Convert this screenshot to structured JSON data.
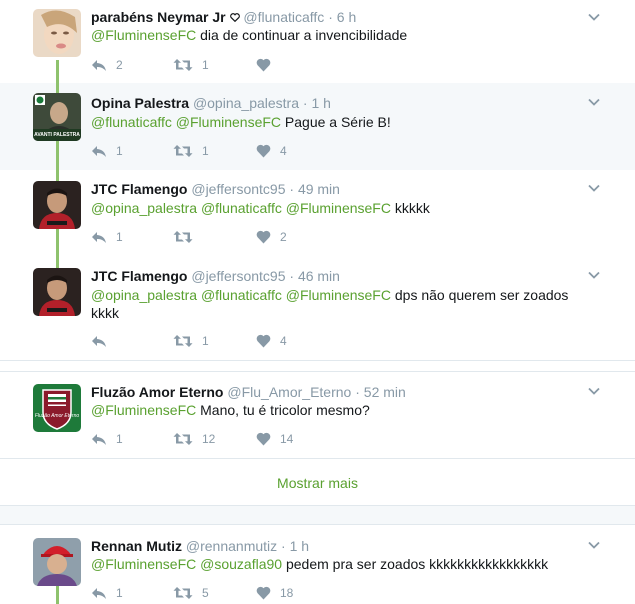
{
  "tweets": [
    {
      "name": "parabéns Neymar Jr",
      "name_badge": "heart-outline",
      "handle": "@flunaticaffc",
      "dot": "·",
      "time": "6 h",
      "text_parts": [
        "@FluminenseFC",
        " dia de continuar a invencibilidade"
      ],
      "reply_count": "2",
      "retweet_count": "1",
      "like_count": ""
    },
    {
      "name": "Opina Palestra",
      "handle": "@opina_palestra",
      "dot": "·",
      "time": "1 h",
      "avatar_text": "AVANTI PALESTRA",
      "text_parts": [
        "@flunaticaffc",
        " ",
        "@FluminenseFC",
        " Pague a Série B!"
      ],
      "reply_count": "1",
      "retweet_count": "1",
      "like_count": "4"
    },
    {
      "name": "JTC Flamengo",
      "handle": "@jeffersontc95",
      "dot": "·",
      "time": "49 min",
      "text_parts": [
        "@opina_palestra",
        " ",
        "@flunaticaffc",
        " ",
        "@FluminenseFC",
        " kkkkk"
      ],
      "reply_count": "1",
      "retweet_count": "",
      "like_count": "2"
    },
    {
      "name": "JTC Flamengo",
      "handle": "@jeffersontc95",
      "dot": "·",
      "time": "46 min",
      "text_parts": [
        "@opina_palestra",
        " ",
        "@flunaticaffc",
        " ",
        "@FluminenseFC",
        " dps não querem ser zoados",
        "kkkk"
      ],
      "reply_count": "",
      "retweet_count": "1",
      "like_count": "4"
    },
    {
      "name": "Fluzão Amor Eterno",
      "handle": "@Flu_Amor_Eterno",
      "dot": "·",
      "time": "52 min",
      "avatar_text": "Fluzão Amor Eterno",
      "text_parts": [
        "@FluminenseFC",
        " Mano, tu é tricolor mesmo?"
      ],
      "reply_count": "1",
      "retweet_count": "12",
      "like_count": "14"
    },
    {
      "name": "Rennan Mutiz",
      "handle": "@rennanmutiz",
      "dot": "·",
      "time": "1 h",
      "text_parts": [
        "@FluminenseFC",
        " ",
        "@souzafla90",
        " pedem pra ser zoados kkkkkkkkkkkkkkkkk"
      ],
      "reply_count": "1",
      "retweet_count": "5",
      "like_count": "18"
    }
  ],
  "show_more_label": "Mostrar mais",
  "colors": {
    "mention": "#5aa130",
    "thread_line": "#8ec26d",
    "muted": "#8899a6",
    "highlight_bg": "#f5f8fa",
    "border": "#e1e8ed"
  },
  "icons": {
    "reply": "reply-icon",
    "retweet": "retweet-icon",
    "like": "heart-icon",
    "more": "chevron-down-icon"
  }
}
